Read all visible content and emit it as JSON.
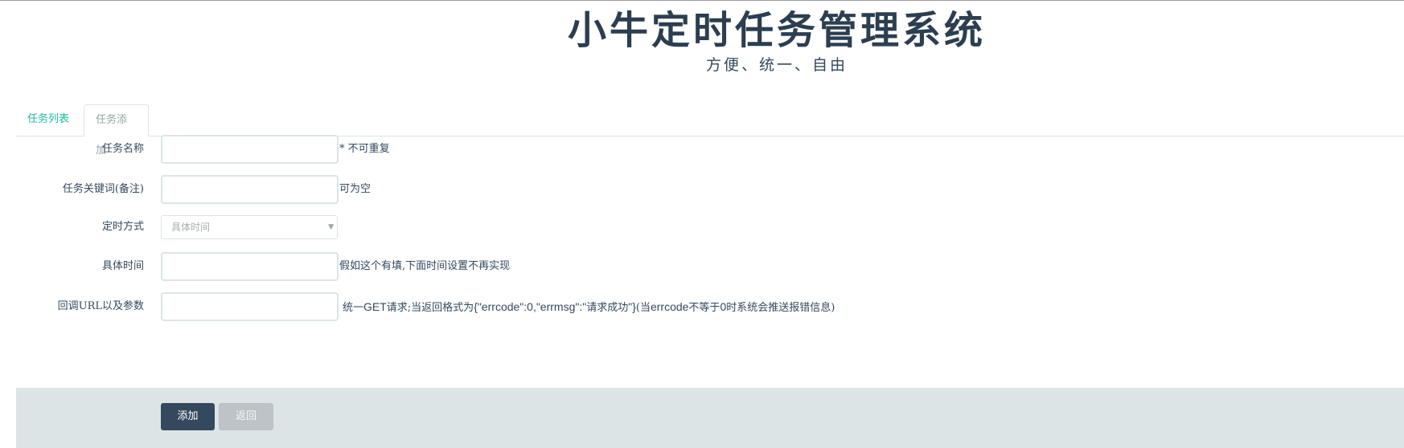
{
  "header": {
    "title": "小牛定时任务管理系统",
    "subtitle": "方便、统一、自由"
  },
  "tabs": [
    {
      "label": "任务列表",
      "active": false
    },
    {
      "label": "任务添加",
      "active": true
    }
  ],
  "form": {
    "task_name": {
      "label": "任务名称",
      "value": "",
      "hint": "* 不可重复"
    },
    "task_keyword": {
      "label": "任务关键词(备注)",
      "value": "",
      "hint": "可为空"
    },
    "schedule_mode": {
      "label": "定时方式",
      "selected": "具体时间"
    },
    "specific_time": {
      "label": "具体时间",
      "value": "",
      "hint": "假如这个有填,下面时间设置不再实现"
    },
    "callback_url": {
      "label": "回调URL以及参数",
      "value": "",
      "hint_prefix": "统一",
      "hint_get": "GET",
      "hint_mid": "请求;当返回格式为",
      "hint_json": "{\"errcode\":0,\"errmsg\":\"",
      "hint_success": "请求成功",
      "hint_json_end": "\"}",
      "hint_paren_open": "(当",
      "hint_errcode": "errcode",
      "hint_not_equal": "不等于",
      "hint_zero": "0",
      "hint_suffix": "时系统会推送报错信息)"
    }
  },
  "buttons": {
    "add_label": "添加",
    "back_label": "返回"
  },
  "icons": {
    "select_caret": "caret-down-icon"
  },
  "colors": {
    "accent": "#1abc9c",
    "primary_button": "#34495e",
    "secondary_button": "#bdc3c7",
    "footer_bg": "#dde4e6"
  }
}
